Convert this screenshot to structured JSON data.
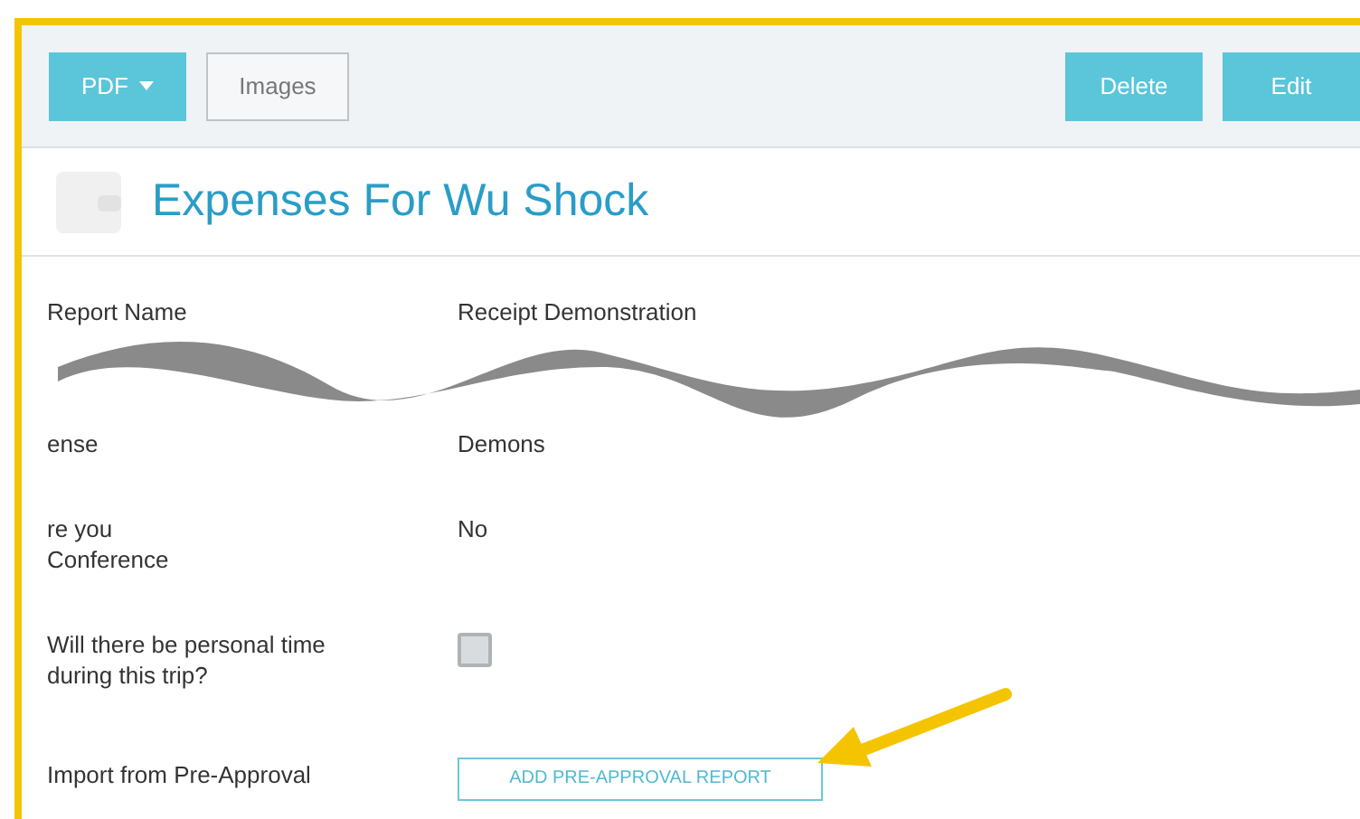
{
  "toolbar": {
    "left_buttons": [
      {
        "label": "PDF",
        "kind": "dropdown"
      },
      {
        "label": "Images",
        "kind": "outline"
      }
    ],
    "right_buttons": [
      {
        "label": "Delete",
        "kind": "solid"
      },
      {
        "label": "Edit",
        "kind": "solid"
      }
    ]
  },
  "title": "Expenses For Wu Shock",
  "fields": [
    {
      "kind": "text",
      "label": "Report Name",
      "value": "Receipt Demonstration"
    },
    {
      "kind": "torn",
      "label": "ense",
      "value": "Demons"
    },
    {
      "kind": "text",
      "label": "re you\nConference",
      "value": "No"
    },
    {
      "kind": "checkbox",
      "label": "Will there be personal time\nduring this trip?",
      "checked": false
    },
    {
      "kind": "button",
      "label": "Import from Pre-Approval",
      "value": "ADD PRE-APPROVAL REPORT"
    }
  ]
}
